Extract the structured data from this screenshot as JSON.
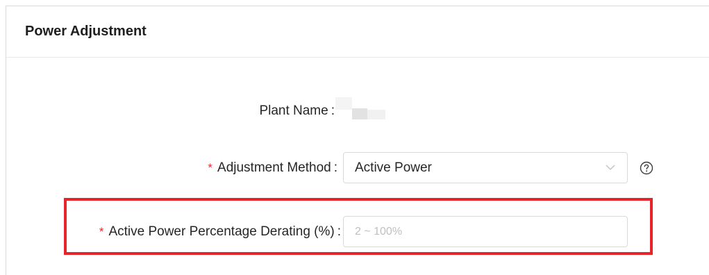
{
  "panel": {
    "title": "Power Adjustment"
  },
  "form": {
    "plant_name": {
      "label": "Plant Name",
      "colon": ":"
    },
    "adjustment_method": {
      "required_mark": "*",
      "label": "Adjustment Method",
      "colon": ":",
      "selected_value": "Active Power",
      "help_icon": "question-circle-icon",
      "dropdown_icon": "chevron-down-icon"
    },
    "derating": {
      "required_mark": "*",
      "label": "Active Power Percentage Derating (%)",
      "colon": ":",
      "value": "",
      "placeholder": "2 ~ 100%"
    }
  },
  "colors": {
    "required": "#f5222d",
    "highlight_border": "#e5252a",
    "input_border": "#d9d9d9",
    "placeholder": "#bfbfbf"
  }
}
